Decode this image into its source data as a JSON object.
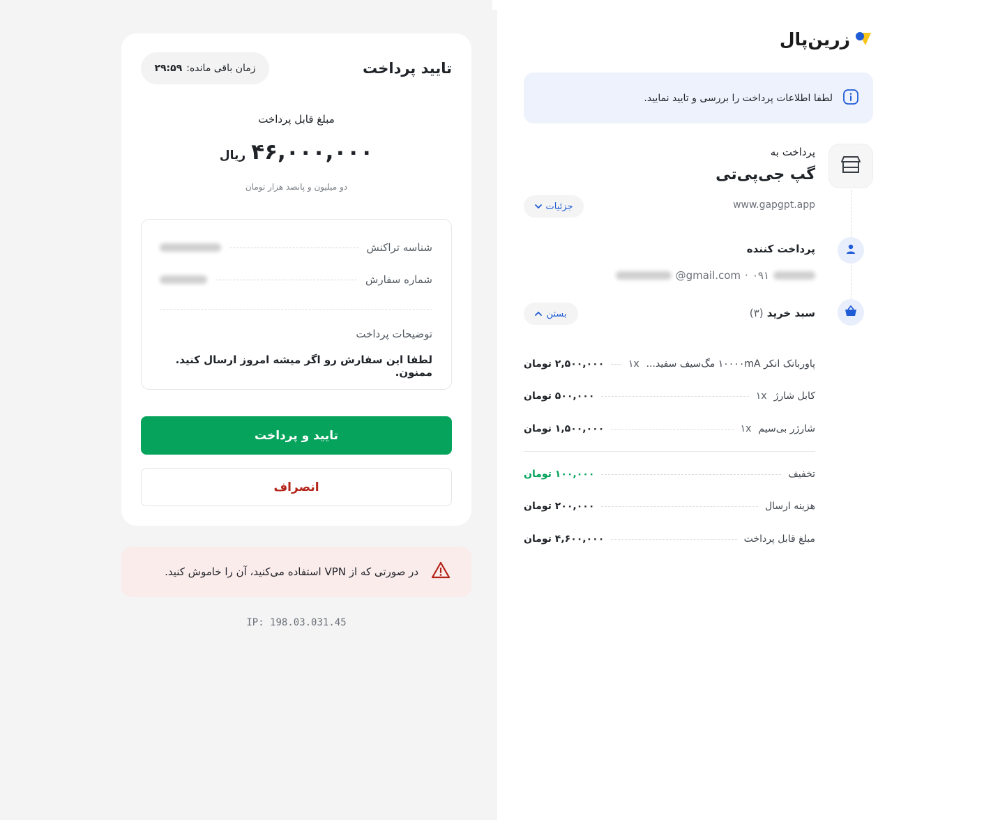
{
  "payment": {
    "title": "تایید پرداخت",
    "timer_label": "زمان باقی مانده:",
    "timer_value": "۲۹:۵۹",
    "amount_label": "مبلغ قابل پرداخت",
    "amount_value": "۴۶,۰۰۰,۰۰۰",
    "amount_unit": "ریال",
    "amount_words": "دو میلیون و پانصد هزار تومان",
    "transaction_id_label": "شناسه تراکنش",
    "order_number_label": "شماره سفارش",
    "description_label": "توضیحات پرداخت",
    "description_text": "لطفا این سفارش رو اگر میشه امروز ارسال کنید. ممنون.",
    "confirm_button": "تایید و پرداخت",
    "cancel_button": "انصراف"
  },
  "vpn_alert": {
    "text": "در صورتی که از VPN استفاده می‌کنید، آن را خاموش کنید."
  },
  "ip_address": "IP: 198.03.031.45",
  "brand": {
    "name": "زرین‌پال",
    "accent_yellow": "#f7c51c",
    "accent_blue": "#1f5cd6"
  },
  "info_banner": {
    "text": "لطفا اطلاعات پرداخت را بررسی و تایید نمایید."
  },
  "merchant": {
    "pay_to_label": "پرداخت به",
    "name": "گپ جی‌پی‌تی",
    "url": "www.gapgpt.app",
    "details_toggle": "جزئیات"
  },
  "payer": {
    "label": "پرداخت کننده",
    "email_visible": "@gmail.com",
    "separator": "·",
    "phone_visible": "۰۹۱"
  },
  "cart": {
    "label": "سبد خرید",
    "count": "(۳)",
    "collapse_toggle": "بستن",
    "items": [
      {
        "name": "پاوربانک انکر ۱۰۰۰۰mA مگ‌سیف سفید...",
        "qty": "۱x",
        "price": "۲,۵۰۰,۰۰۰ تومان"
      },
      {
        "name": "کابل شارژ",
        "qty": "۱x",
        "price": "۵۰۰,۰۰۰ تومان"
      },
      {
        "name": "شارژر بی‌سیم",
        "qty": "۱x",
        "price": "۱,۵۰۰,۰۰۰ تومان"
      }
    ],
    "summary": [
      {
        "label": "تخفیف",
        "value": "۱۰۰,۰۰۰ تومان",
        "highlight": true
      },
      {
        "label": "هزینه ارسال",
        "value": "۲۰۰,۰۰۰ تومان",
        "highlight": false
      },
      {
        "label": "مبلغ قابل پرداخت",
        "value": "۴,۶۰۰,۰۰۰ تومان",
        "highlight": false
      }
    ]
  },
  "colors": {
    "confirm_green": "#05a35c",
    "cancel_red": "#b42318",
    "alert_bg": "#fbecec",
    "info_bg": "#eef2fd"
  },
  "icons": [
    "info-icon",
    "store-icon",
    "user-icon",
    "basket-icon",
    "chevron-down-icon",
    "chevron-up-icon",
    "warning-icon",
    "zarinpal-logo-icon"
  ]
}
